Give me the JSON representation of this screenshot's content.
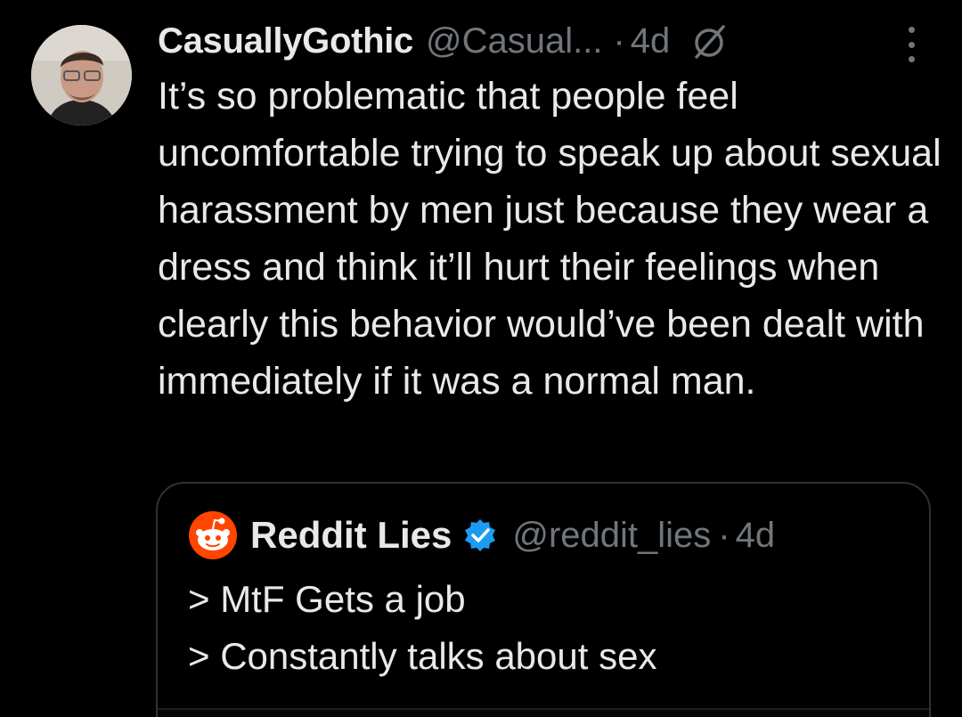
{
  "tweet": {
    "display_name": "CasuallyGothic",
    "handle": "@Casual...",
    "separator": "·",
    "time": "4d",
    "reply_restriction_icon": "no-replies-icon",
    "more_icon": "more-vertical-icon",
    "text": "It’s so problematic that people feel uncomfortable trying to speak up about sexual harassment by men just because they wear a dress and think it’ll hurt their feelings when clearly this behavior would’ve been dealt with immediately if it was a normal man."
  },
  "quote": {
    "display_name": "Reddit Lies",
    "verified_icon": "verified-badge-icon",
    "logo_icon": "reddit-logo-icon",
    "handle": "@reddit_lies",
    "separator": "·",
    "time": "4d",
    "lines": [
      "> MtF Gets a job",
      "> Constantly talks about sex"
    ]
  },
  "colors": {
    "background": "#000000",
    "primary_text": "#e7e9ea",
    "secondary_text": "#71767b",
    "border": "#2f3336",
    "verified_blue": "#1d9bf0",
    "reddit_orange": "#ff4500"
  }
}
